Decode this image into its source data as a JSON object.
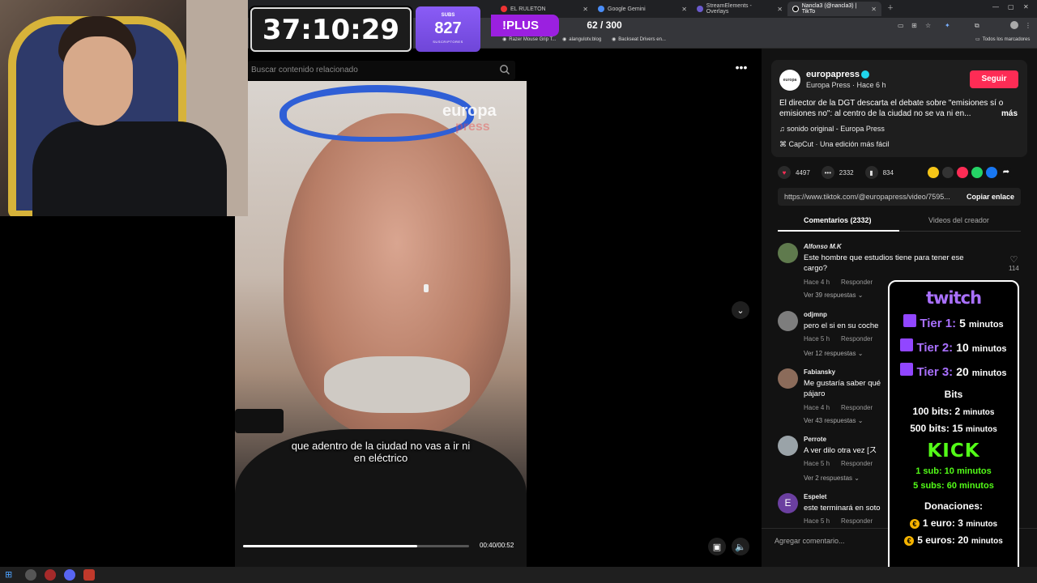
{
  "browser": {
    "tabs": [
      {
        "label": "EL RULETON",
        "active": false
      },
      {
        "label": "Google Gemini",
        "active": false
      },
      {
        "label": "StreamElements - Overlays",
        "active": false
      },
      {
        "label": "Nancla3 (@nancla3) | TikTo",
        "active": true
      }
    ],
    "bookmarks": [
      "Razer Mouse Grip T...",
      "alangulotv.blog",
      "Backseat Drivers en..."
    ],
    "bookmarks_right": "Todos los marcadores"
  },
  "overlay": {
    "timer": "37:10:29",
    "subs_label": "SUBS",
    "subs_count": "827",
    "subs_sub": "SUSCRIPTORES",
    "plus_label": "!PLUS",
    "goal": "62 / 300"
  },
  "search": {
    "placeholder": "Buscar contenido relacionado"
  },
  "video": {
    "watermark_top": "europa",
    "watermark_bottom": "press",
    "caption_line1": "que adentro de la ciudad no vas a ir ni",
    "caption_line2": "en eléctrico",
    "time": "00:40/00:52",
    "progress_fraction": 0.77
  },
  "post": {
    "avatar_text": "europa press",
    "author": "europapress",
    "author_sub": "Europa Press · Hace 6 h",
    "follow_label": "Seguir",
    "description": "El director de la DGT descarta el debate sobre \"emisiones sí o emisiones no\": al centro de la ciudad no se va ni en...",
    "more_label": "más",
    "music": "sonido original - Europa Press",
    "capcut": "CapCut · Una edición más fácil",
    "likes": "4497",
    "comments": "2332",
    "saves": "834",
    "url": "https://www.tiktok.com/@europapress/video/7595...",
    "copy_label": "Copiar enlace"
  },
  "comments_tabs": {
    "comments": "Comentarios (2332)",
    "creator_videos": "Videos del creador"
  },
  "comments": [
    {
      "user": "Alfonso M.K",
      "text": "Este hombre que estudios tiene para tener ese cargo?",
      "time": "Hace 4 h",
      "reply": "Responder",
      "replies": "Ver 39 respuestas",
      "likes": "114"
    },
    {
      "user": "odjmnp",
      "text": "pero el si en su coche",
      "time": "Hace 5 h",
      "reply": "Responder",
      "replies": "Ver 12 respuestas"
    },
    {
      "user": "Fabiansky",
      "text": "Me gustaría saber qué pájaro",
      "time": "Hace 4 h",
      "reply": "Responder",
      "replies": "Ver 43 respuestas"
    },
    {
      "user": "Perrote",
      "text": "A ver dilo otra vez [ス",
      "time": "Hace 5 h",
      "reply": "Responder",
      "replies": "Ver 2 respuestas"
    },
    {
      "user": "Espelet",
      "avatar_letter": "E",
      "text": "este terminará en soto",
      "time": "Hace 5 h",
      "reply": "Responder"
    }
  ],
  "add_comment_placeholder": "Agregar comentario...",
  "donations": {
    "twitch": "twitch",
    "tier1_label": "Tier 1:",
    "tier1_value": "5",
    "tier1_unit": "minutos",
    "tier2_label": "Tier 2:",
    "tier2_value": "10",
    "tier2_unit": "minutos",
    "tier3_label": "Tier 3:",
    "tier3_value": "20",
    "tier3_unit": "minutos",
    "bits_title": "Bits",
    "bits1": "100 bits: 2",
    "bits1_unit": "minutos",
    "bits2": "500 bits: 15",
    "bits2_unit": "minutos",
    "kick": "KICK",
    "kick1": "1 sub: 10 minutos",
    "kick2": "5 subs: 60 minutos",
    "donations_title": "Donaciones:",
    "don1": "1 euro: 3",
    "don1_unit": "minutos",
    "don2": "5 euros: 20",
    "don2_unit": "minutos"
  },
  "colors": {
    "tiktok_red": "#fe2c55",
    "twitch_purple": "#a970ff",
    "kick_green": "#53fc18",
    "subs_purple": "#8a5cf6"
  }
}
